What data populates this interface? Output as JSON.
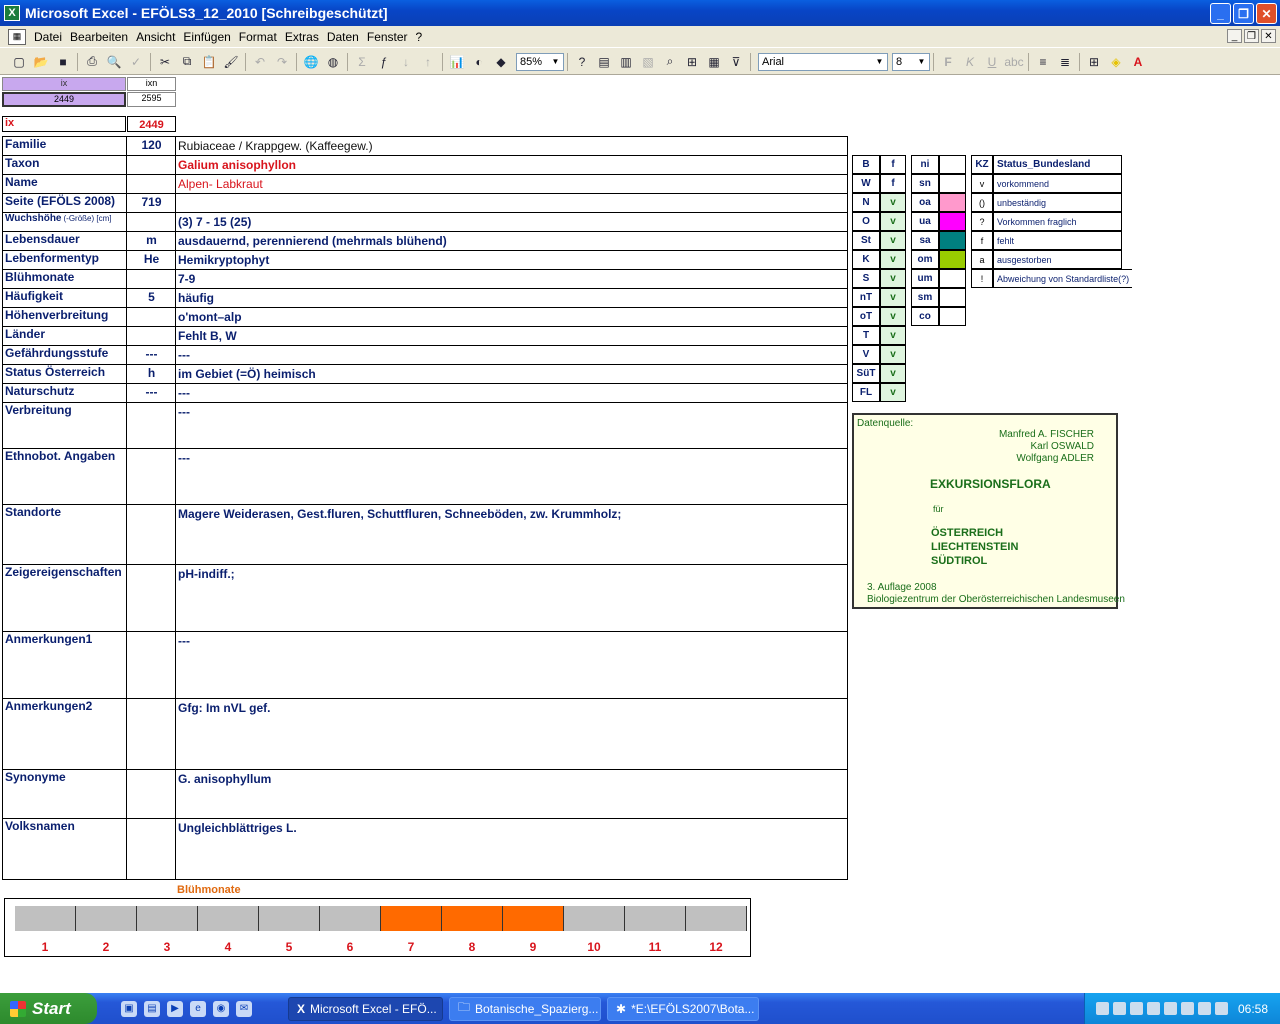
{
  "window": {
    "title": "Microsoft Excel - EFÖLS3_12_2010  [Schreibgeschützt]",
    "app_icon": "excel-icon"
  },
  "menu": [
    "Datei",
    "Bearbeiten",
    "Ansicht",
    "Einfügen",
    "Format",
    "Extras",
    "Daten",
    "Fenster",
    "?"
  ],
  "toolbar": {
    "zoom": "85%",
    "font_name": "Arial",
    "font_size": "8"
  },
  "index": {
    "ix_header": "ix",
    "ixn_header": "ixn",
    "ix_value": "2449",
    "ixn_value": "2595",
    "ix_label": "ix",
    "ix_red_value": "2449"
  },
  "rows": [
    {
      "label": "Familie",
      "code": "120",
      "value": "Rubiaceae  /  Krappgew. (Kaffeegew.)"
    },
    {
      "label": "Taxon",
      "code": "",
      "value": "Galium anisophyllon"
    },
    {
      "label": "Name",
      "code": "",
      "value": "Alpen- Labkraut"
    },
    {
      "label": "Seite (EFÖLS 2008)",
      "code": "719",
      "value": ""
    },
    {
      "label": "Wuchshöhe",
      "label_suffix": "(-Größe) [cm]",
      "code": "",
      "value": "(3) 7 - 15 (25)"
    },
    {
      "label": "Lebensdauer",
      "code": "m",
      "value": "ausdauernd, perennierend (mehrmals blühend)"
    },
    {
      "label": "Lebenformentyp",
      "code": "He",
      "value": "Hemikryptophyt"
    },
    {
      "label": "Blühmonate",
      "code": "",
      "value": "7-9"
    },
    {
      "label": "Häufigkeit",
      "code": "5",
      "value": "häufig"
    },
    {
      "label": "Höhenverbreitung",
      "code": "",
      "value": "o'mont–alp"
    },
    {
      "label": "Länder",
      "code": "",
      "value": "Fehlt B, W"
    },
    {
      "label": "Gefährdungsstufe",
      "code": "---",
      "value": "---"
    },
    {
      "label": "Status Österreich",
      "code": "h",
      "value": "im Gebiet (=Ö) heimisch"
    },
    {
      "label": "Naturschutz",
      "code": "---",
      "value": "---"
    },
    {
      "label": "Verbreitung",
      "code": "",
      "value": "---"
    },
    {
      "label": "Ethnobot. Angaben",
      "code": "",
      "value": "---"
    },
    {
      "label": "Standorte",
      "code": "",
      "value": "Magere Weiderasen, Gest.fluren, Schuttfluren, Schneeböden, zw. Krummholz;"
    },
    {
      "label": "Zeigereigenschaften",
      "code": "",
      "value": "pH-indiff.;"
    },
    {
      "label": "Anmerkungen1",
      "code": "",
      "value": "---"
    },
    {
      "label": "Anmerkungen2",
      "code": "",
      "value": "Gfg: Im nVL gef."
    },
    {
      "label": "Synonyme",
      "code": "",
      "value": "G. anisophyllum"
    },
    {
      "label": "Volksnamen",
      "code": "",
      "value": "Ungleichblättriges L."
    }
  ],
  "regions": [
    {
      "code": "B",
      "status": "f"
    },
    {
      "code": "W",
      "status": "f"
    },
    {
      "code": "N",
      "status": "v"
    },
    {
      "code": "O",
      "status": "v"
    },
    {
      "code": "St",
      "status": "v"
    },
    {
      "code": "K",
      "status": "v"
    },
    {
      "code": "S",
      "status": "v"
    },
    {
      "code": "nT",
      "status": "v"
    },
    {
      "code": "oT",
      "status": "v"
    },
    {
      "code": "T",
      "status": "v"
    },
    {
      "code": "V",
      "status": "v"
    },
    {
      "code": "SüT",
      "status": "v"
    },
    {
      "code": "FL",
      "status": "v"
    }
  ],
  "neighbors": [
    {
      "code": "ni",
      "color": ""
    },
    {
      "code": "sn",
      "color": ""
    },
    {
      "code": "oa",
      "color": "#ff99cc"
    },
    {
      "code": "ua",
      "color": "#ff00ff"
    },
    {
      "code": "sa",
      "color": "#008080"
    },
    {
      "code": "om",
      "color": "#99cc00"
    },
    {
      "code": "um",
      "color": ""
    },
    {
      "code": "sm",
      "color": ""
    },
    {
      "code": "co",
      "color": ""
    }
  ],
  "kz": {
    "header_code": "KZ",
    "header_label": "Status_Bundesland",
    "items": [
      {
        "code": "v",
        "label": "vorkommend"
      },
      {
        "code": "()",
        "label": "unbeständig"
      },
      {
        "code": "?",
        "label": "Vorkommen fraglich"
      },
      {
        "code": "f",
        "label": "fehlt"
      },
      {
        "code": "a",
        "label": "ausgestorben"
      },
      {
        "code": "!",
        "label": "Abweichung von Standardliste(?)"
      }
    ]
  },
  "source": {
    "label": "Datenquelle:",
    "authors": [
      "Manfred A. FISCHER",
      "Karl OSWALD",
      "Wolfgang ADLER"
    ],
    "title": "EXKURSIONSFLORA",
    "fuer": "für",
    "countries": [
      "ÖSTERREICH",
      "LIECHTENSTEIN",
      "SÜDTIROL"
    ],
    "edition": "3. Auflage 2008",
    "publisher": "Biologiezentrum der Oberösterreichischen Landesmuseen"
  },
  "bloom": {
    "title": "Blühmonate",
    "months": [
      "1",
      "2",
      "3",
      "4",
      "5",
      "6",
      "7",
      "8",
      "9",
      "10",
      "11",
      "12"
    ],
    "active": [
      false,
      false,
      false,
      false,
      false,
      false,
      true,
      true,
      true,
      false,
      false,
      false
    ],
    "active_color": "#ff6a00",
    "inactive_color": "#c0c0c0"
  },
  "taskbar": {
    "start": "Start",
    "tasks": [
      "Microsoft Excel - EFÖ...",
      "Botanische_Spazierg...",
      "*E:\\EFÖLS2007\\Bota..."
    ],
    "clock": "06:58"
  }
}
